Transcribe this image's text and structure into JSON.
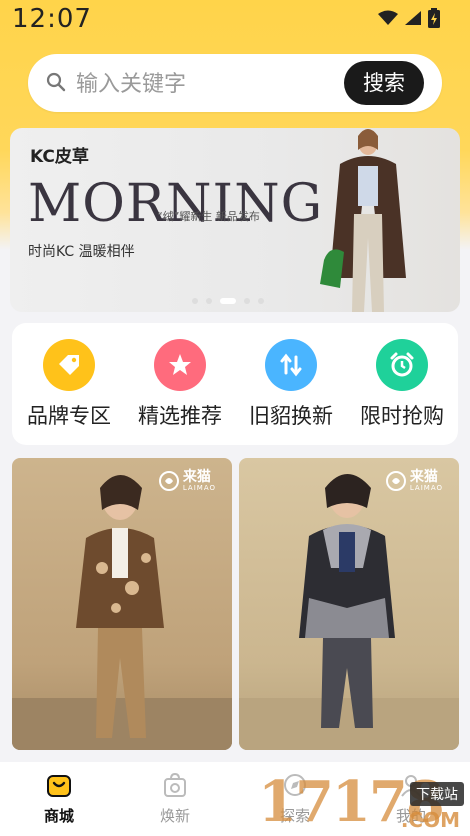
{
  "status_bar": {
    "time": "12:07"
  },
  "search": {
    "placeholder": "输入关键字",
    "button_label": "搜索"
  },
  "banner": {
    "brand": "KC皮草",
    "headline": "MORNING",
    "subline": "“绒”耀新生  新品发布",
    "tagline": "时尚KC 温暖相伴",
    "dots_total": 5,
    "dot_active": 3
  },
  "categories": [
    {
      "label": "品牌专区",
      "icon": "tag-icon",
      "color": "#ffc21a"
    },
    {
      "label": "精选推荐",
      "icon": "star-icon",
      "color": "#ff6b7d"
    },
    {
      "label": "旧貂换新",
      "icon": "swap-icon",
      "color": "#4ab5ff"
    },
    {
      "label": "限时抢购",
      "icon": "alarm-clock-icon",
      "color": "#1fd19a"
    }
  ],
  "products": [
    {
      "badge_cn": "来猫",
      "badge_en": "LAIMAO"
    },
    {
      "badge_cn": "来猫",
      "badge_en": "LAIMAO"
    }
  ],
  "tabbar": [
    {
      "label": "商城",
      "icon": "shop-bag-icon",
      "active": true
    },
    {
      "label": "焕新",
      "icon": "refresh-bag-icon",
      "active": false
    },
    {
      "label": "探索",
      "icon": "explore-icon",
      "active": false
    },
    {
      "label": "我的",
      "icon": "user-icon",
      "active": false
    }
  ],
  "watermark": {
    "text": "17178",
    "caption": "下载站",
    "domain": ".COM"
  },
  "colors": {
    "accent_yellow": "#ffd44a",
    "dark_button": "#1a1a1a"
  }
}
